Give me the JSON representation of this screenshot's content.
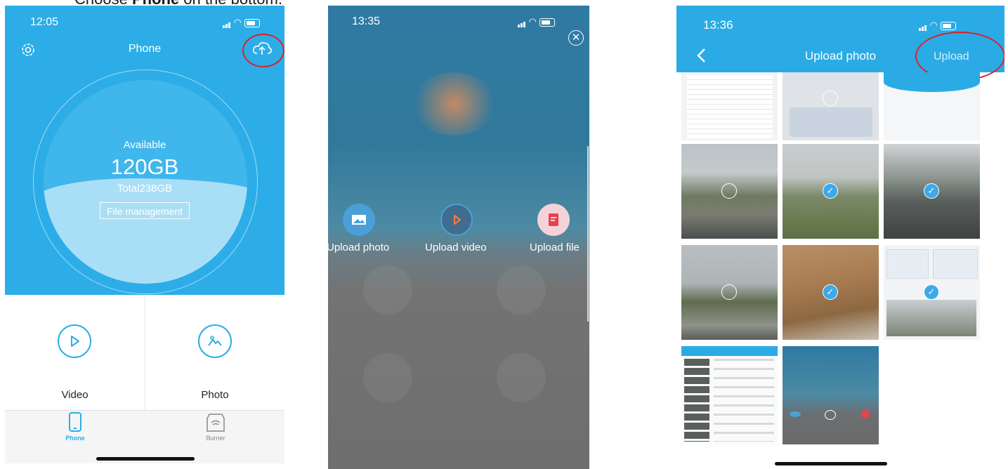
{
  "caption": {
    "prefix": "Choose ",
    "bold": "Phone",
    "suffix": " on the bottom."
  },
  "screen1": {
    "time": "12:05",
    "title": "Phone",
    "available_label": "Available",
    "available_value": "120GB",
    "total_label": "Total238GB",
    "file_management_label": "File management",
    "grid": [
      {
        "label": "Video",
        "icon": "play-icon"
      },
      {
        "label": "Photo",
        "icon": "photo-icon"
      }
    ],
    "tabs": [
      {
        "label": "Phone",
        "active": true
      },
      {
        "label": "Burner",
        "active": false
      }
    ],
    "accent_color": "#2cade8",
    "highlight_color": "#d8232a"
  },
  "screen2": {
    "time": "13:35",
    "actions": [
      {
        "label": "Upload photo",
        "icon": "image-icon"
      },
      {
        "label": "Upload video",
        "icon": "play-icon"
      },
      {
        "label": "Upload file",
        "icon": "file-icon"
      }
    ]
  },
  "screen3": {
    "time": "13:36",
    "title": "Upload photo",
    "upload_label": "Upload",
    "thumbnails": [
      {
        "kind": "settings-screenshot",
        "selected": null
      },
      {
        "kind": "password-screenshot",
        "selected": false
      },
      {
        "kind": "app-screenshot",
        "selected": null
      },
      {
        "kind": "car-park-photo",
        "selected": false
      },
      {
        "kind": "car-park-photo",
        "selected": true
      },
      {
        "kind": "car-park-photo",
        "selected": true
      },
      {
        "kind": "car-park-photo",
        "selected": false
      },
      {
        "kind": "parcel-photo",
        "selected": true
      },
      {
        "kind": "upload-screen-screenshot",
        "selected": true
      },
      {
        "kind": "file-list-screenshot",
        "selected": null
      },
      {
        "kind": "upload-menu-screenshot",
        "selected": null
      }
    ]
  }
}
